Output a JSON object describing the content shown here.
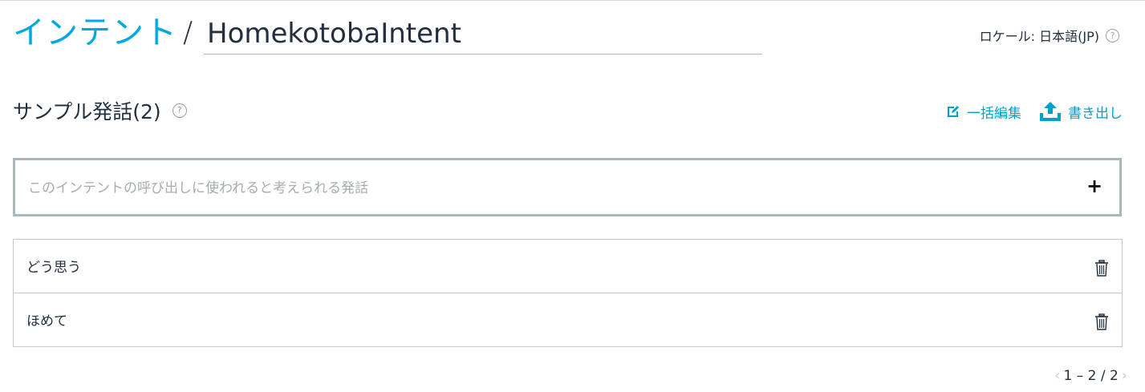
{
  "header": {
    "breadcrumb_link": "インテント",
    "breadcrumb_sep": "/",
    "intent_name": "HomekotobaIntent",
    "locale_label": "ロケール: 日本語(JP)",
    "help_glyph": "?"
  },
  "samples": {
    "title": "サンプル発話(2)",
    "help_glyph": "?",
    "bulk_edit_label": "一括編集",
    "export_label": "書き出し",
    "input_placeholder": "このインテントの呼び出しに使われると考えられる発話",
    "add_glyph": "+",
    "items": [
      {
        "text": "どう思う"
      },
      {
        "text": "ほめて"
      }
    ]
  },
  "pagination": {
    "prev_glyph": "‹",
    "range": "1 – 2 / 2",
    "next_glyph": "›"
  },
  "colors": {
    "accent": "#00a8e1",
    "action": "#00a1c9",
    "text": "#232f3e",
    "border": "#aab7b8"
  },
  "icons": [
    "help-icon",
    "bulk-edit-icon",
    "export-icon",
    "plus-icon",
    "trash-icon",
    "chevron-left-icon",
    "chevron-right-icon"
  ]
}
